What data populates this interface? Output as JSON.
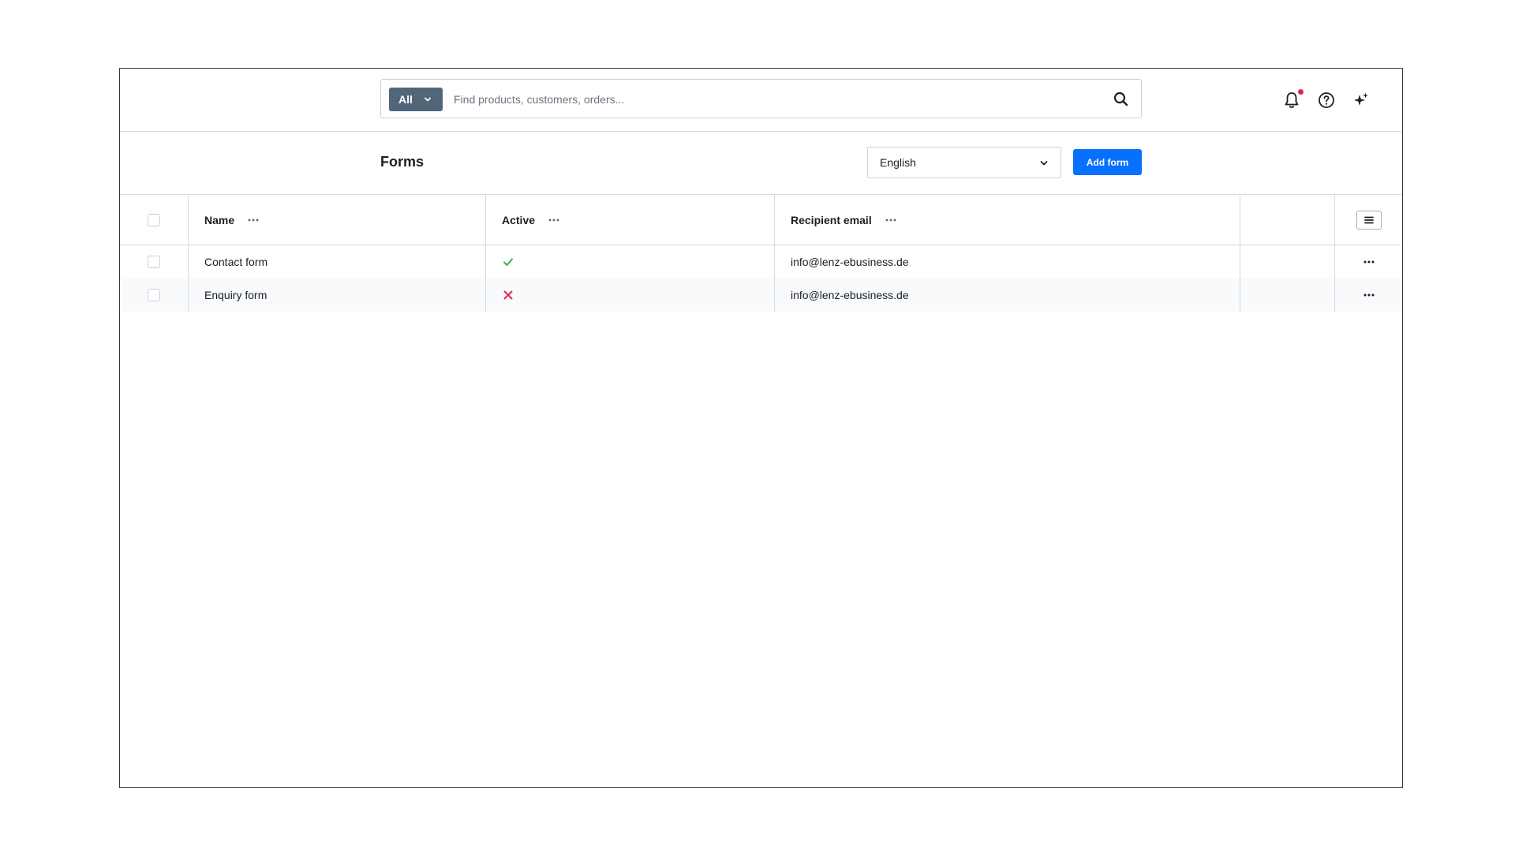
{
  "search": {
    "scope_label": "All",
    "placeholder": "Find products, customers, orders...",
    "value": ""
  },
  "topbar": {
    "icons": [
      "bell-icon",
      "help-circle-icon",
      "sparkle-icon"
    ],
    "notification_dot_color": "#de294c"
  },
  "header": {
    "title": "Forms",
    "language": "English",
    "add_label": "Add form",
    "accent_color": "#0870ff"
  },
  "table": {
    "columns": [
      "Name",
      "Active",
      "Recipient email"
    ],
    "rows": [
      {
        "name": "Contact form",
        "active": true,
        "email": "info@lenz-ebusiness.de"
      },
      {
        "name": "Enquiry form",
        "active": false,
        "email": "info@lenz-ebusiness.de"
      }
    ],
    "active_color": "#37b05a",
    "inactive_color": "#de294c"
  }
}
